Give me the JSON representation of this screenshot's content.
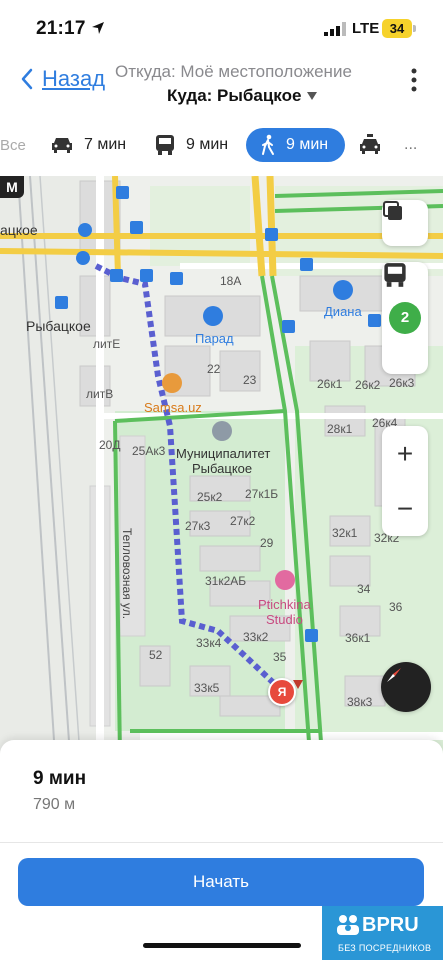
{
  "status": {
    "time": "21:17",
    "network": "LTE",
    "battery": "34"
  },
  "header": {
    "back_label": "Назад",
    "from_text": "Откуда: Моё местоположение",
    "to_text": "Куда: Рыбацкое"
  },
  "tabs": {
    "all_label": "Все",
    "car_time": "7 мин",
    "bus_time": "9 мин",
    "walk_time": "9 мин",
    "more_label": "..."
  },
  "map": {
    "labels": {
      "metro_station": "ацкое",
      "metro_station_2": "Рыбацкое",
      "diana": "Диана",
      "parad": "Парад",
      "samsa": "Samsa.uz",
      "municipality_1": "Муниципалитет",
      "municipality_2": "Рыбацкое",
      "ptichkina_1": "Ptichkina",
      "ptichkina_2": "Studio",
      "street": "Тепловозная ул.",
      "b18a": "18А",
      "litE": "литЕ",
      "litV": "литВ",
      "b22": "22",
      "b23": "23",
      "b20d": "20Д",
      "b25ak3": "25Ак3",
      "b25k2": "25к2",
      "b27k1b": "27к1Б",
      "b27k3": "27к3",
      "b27k2": "27к2",
      "b29": "29",
      "b31k2ab": "31к2АБ",
      "b33k4": "33к4",
      "b33k2": "33к2",
      "b35": "35",
      "b33k5": "33к5",
      "b52": "52",
      "b26k1": "26к1",
      "b26k2": "26к2",
      "b26k3": "26к3",
      "b28k1": "28к1",
      "b26k4": "26к4",
      "b32k1": "32к1",
      "b32k2": "32к2",
      "b34": "34",
      "b36": "36",
      "b36k1": "36к1",
      "b38k3": "38к3",
      "pin_letter": "Я",
      "m_badge": "М"
    },
    "layers_badge": "2",
    "zoom_in": "+",
    "zoom_out": "−"
  },
  "sheet": {
    "duration": "9 мин",
    "distance": "790 м",
    "start_label": "Начать"
  },
  "watermark": {
    "title": "BPRU",
    "subtitle": "БЕЗ ПОСРЕДНИКОВ"
  },
  "colors": {
    "accent": "#2f7ddf",
    "route": "#5a5fd0",
    "pin": "#e74a3c",
    "road_yellow": "#f3cd45",
    "road_green": "#5cbf5c"
  }
}
